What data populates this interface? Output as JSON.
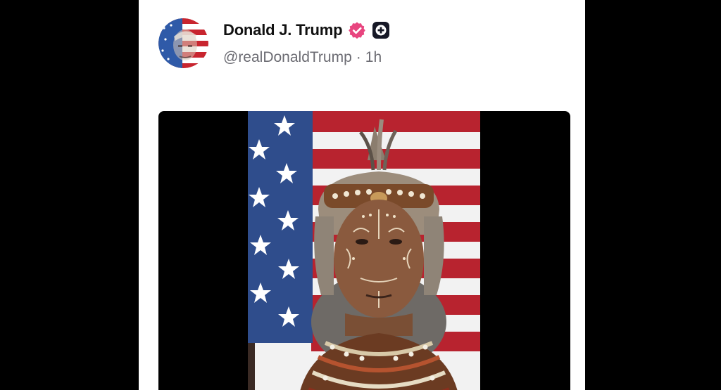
{
  "post": {
    "author": {
      "display_name": "Donald J. Trump",
      "handle": "@realDonaldTrump",
      "avatar_icon": "flag-portrait-avatar",
      "verified_icon": "verified-badge-icon",
      "verified_color": "#e8457f",
      "extra_badge_icon": "plus-badge-icon"
    },
    "separator": "·",
    "timestamp": "1h",
    "media": {
      "kind": "image",
      "background_color": "#000000"
    }
  },
  "colors": {
    "page_background": "#000000",
    "card_background": "#ffffff",
    "name_color": "#111111",
    "handle_color": "#6b6b72",
    "flag_red": "#b22234",
    "flag_blue": "#2f4d8c"
  }
}
